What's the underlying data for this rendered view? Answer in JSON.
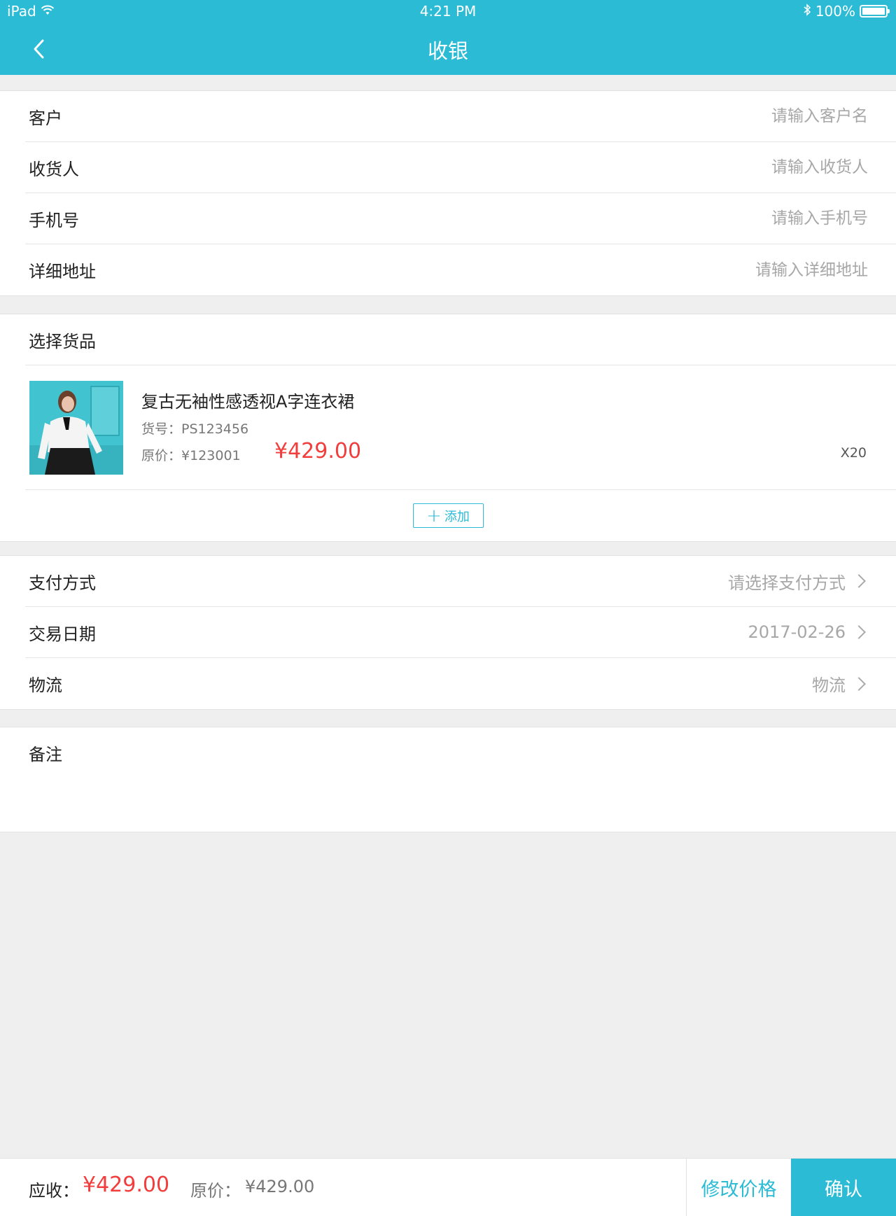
{
  "status_bar": {
    "device": "iPad",
    "time": "4:21 PM",
    "battery": "100%"
  },
  "nav": {
    "title": "收银"
  },
  "customer_form": {
    "customer": {
      "label": "客户",
      "placeholder": "请输入客户名"
    },
    "consignee": {
      "label": "收货人",
      "placeholder": "请输入收货人"
    },
    "phone": {
      "label": "手机号",
      "placeholder": "请输入手机号"
    },
    "address": {
      "label": "详细地址",
      "placeholder": "请输入详细地址"
    }
  },
  "goods": {
    "section_label": "选择货品",
    "item": {
      "name": "复古无袖性感透视A字连衣裙",
      "code": "货号：PS123456",
      "original_price": "原价：¥123001",
      "price": "¥429.00",
      "quantity": "X20"
    },
    "add_label": "添加"
  },
  "options": {
    "payment": {
      "label": "支付方式",
      "value": "请选择支付方式"
    },
    "date": {
      "label": "交易日期",
      "value": "2017-02-26"
    },
    "logistics": {
      "label": "物流",
      "value": "物流"
    }
  },
  "notes": {
    "label": "备注"
  },
  "footer": {
    "due_label": "应收：",
    "due_value": "¥429.00",
    "original_label": "原价：",
    "original_value": "¥429.00",
    "modify_label": "修改价格",
    "confirm_label": "确认"
  },
  "colors": {
    "accent": "#2bbbd5",
    "price": "#f23d3d",
    "background": "#efefef"
  }
}
